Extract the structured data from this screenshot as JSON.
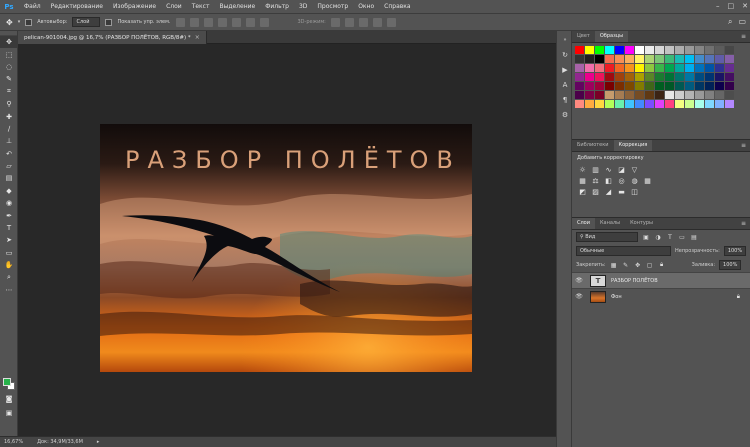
{
  "app": {
    "logo": "Ps",
    "menu": [
      "Файл",
      "Редактирование",
      "Изображение",
      "Слои",
      "Текст",
      "Выделение",
      "Фильтр",
      "3D",
      "Просмотр",
      "Окно",
      "Справка"
    ],
    "window_controls": [
      "–",
      "□",
      "✕"
    ]
  },
  "options": {
    "autoselect_label": "Автовыбор:",
    "autoselect_value": "Слой",
    "show_controls_label": "Показать упр. элем.",
    "mode_3d_label": "3D-режим:"
  },
  "document": {
    "tab_title": "pelican-901004.jpg @ 16,7% (РАЗБОР ПОЛЁТОВ, RGB/8#) *",
    "tab_close": "×",
    "canvas_text": "РАЗБОР ПОЛЁТОВ"
  },
  "status": {
    "zoom": "16,67%",
    "doc_size": "Док: 34,9M/33,6M",
    "arrow": "▸"
  },
  "panels": {
    "top_tabs": [
      "Цвет",
      "Образцы"
    ],
    "mid_tabs": [
      "Библиотеки",
      "Коррекция"
    ],
    "adjustments_title": "Добавить корректировку",
    "layers_tabs": [
      "Слои",
      "Каналы",
      "Контуры"
    ],
    "kind_select": "⚲ Вид",
    "blend_mode": "Обычные",
    "opacity_label": "Непрозрачность:",
    "opacity_value": "100%",
    "lock_label": "Закрепить:",
    "fill_label": "Заливка:",
    "fill_value": "100%",
    "layers": [
      {
        "name": "РАЗБОР ПОЛЁТОВ",
        "thumb": "T",
        "selected": true
      },
      {
        "name": "Фон",
        "thumb": "",
        "selected": false
      }
    ]
  },
  "colors": {
    "foreground": "#27b24a",
    "background": "#ffffff",
    "title_text": "#d9a079",
    "swatches": [
      "#ff0000",
      "#ffff00",
      "#00ff00",
      "#00ffff",
      "#0000ff",
      "#ff00ff",
      "#ffffff",
      "#ebebeb",
      "#d6d6d6",
      "#c2c2c2",
      "#adadad",
      "#999999",
      "#858585",
      "#707070",
      "#5c5c5c",
      "#474747",
      "#333333",
      "#1f1f1f",
      "#000000",
      "#f26c4f",
      "#f68e56",
      "#fbaf5d",
      "#fff467",
      "#acd373",
      "#7cc576",
      "#3bb878",
      "#1abbb4",
      "#00bff3",
      "#438ccb",
      "#5574b9",
      "#605ca8",
      "#855fa8",
      "#a763a8",
      "#f06eaa",
      "#f26d7d",
      "#ed1c24",
      "#f26522",
      "#f7941d",
      "#fff200",
      "#8dc73f",
      "#39b54a",
      "#00a651",
      "#00a99d",
      "#00aeef",
      "#0072bc",
      "#0054a6",
      "#2e3192",
      "#662d91",
      "#92278f",
      "#ec008c",
      "#ed145b",
      "#9e0b0f",
      "#a0410d",
      "#a3620a",
      "#aba000",
      "#598527",
      "#1a7b30",
      "#007236",
      "#00746b",
      "#0076a3",
      "#004b80",
      "#003471",
      "#1b1464",
      "#440e62",
      "#630460",
      "#9e005d",
      "#9e0039",
      "#790000",
      "#7b2e00",
      "#7d4900",
      "#827b00",
      "#406618",
      "#005e20",
      "#005826",
      "#005952",
      "#005b7f",
      "#003663",
      "#002157",
      "#0d004c",
      "#32004b",
      "#4b0049",
      "#7b0046",
      "#7a0026",
      "#c69c6d",
      "#a67c52",
      "#8c6239",
      "#754c24",
      "#603913",
      "#3c2415",
      "#e6e6e6",
      "#cccccc",
      "#b3b3b3",
      "#999999",
      "#808080",
      "#666666",
      "#4d4d4d",
      "#ff8a80",
      "#ffab40",
      "#ffd740",
      "#b2ff59",
      "#69f0ae",
      "#40c4ff",
      "#448aff",
      "#7c4dff",
      "#e040fb",
      "#ff4081",
      "#f4ff81",
      "#ccff90",
      "#a7ffeb",
      "#80d8ff",
      "#82b1ff",
      "#b388ff"
    ]
  }
}
